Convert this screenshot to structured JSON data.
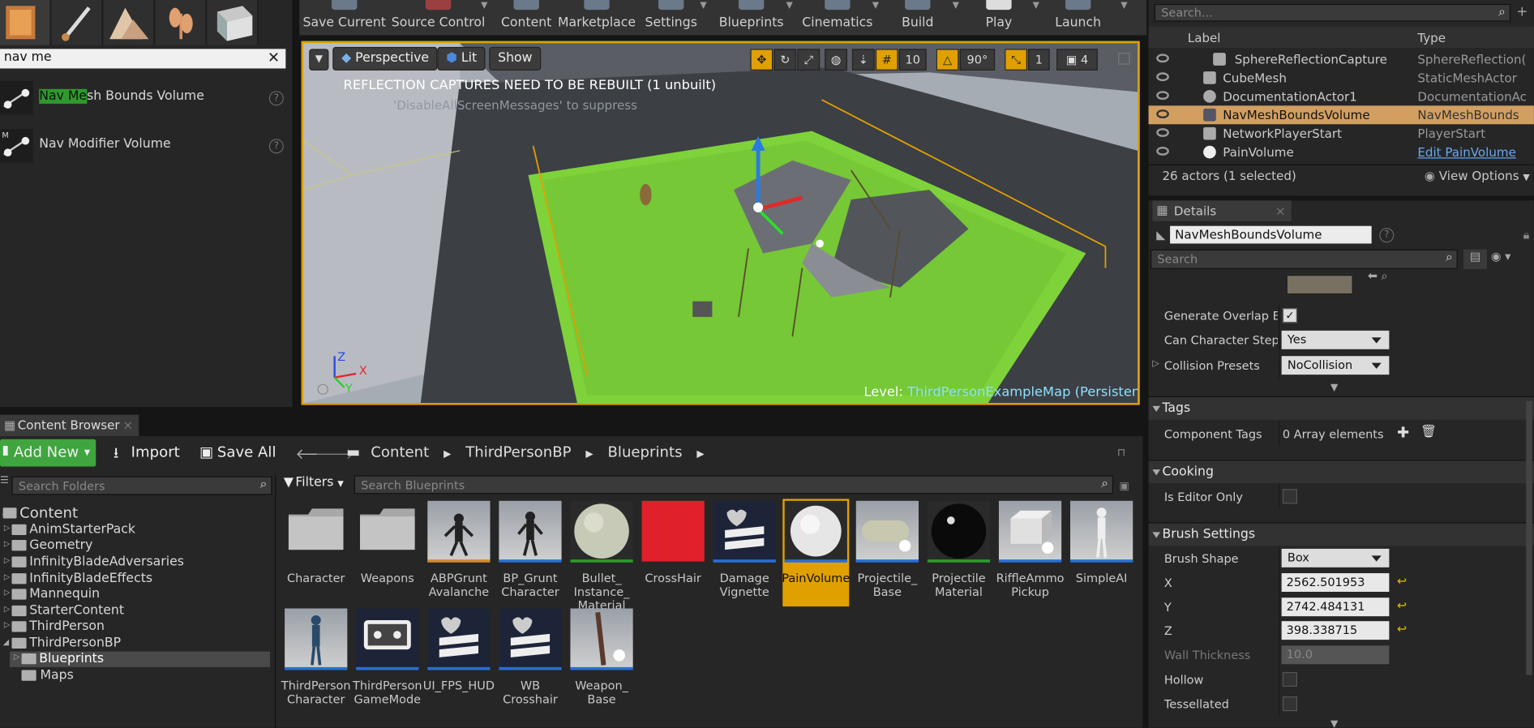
{
  "place": {
    "search_value": "nav me",
    "items": [
      {
        "pre": "Nav Me",
        "rest": "sh Bounds Volume"
      },
      {
        "pre": "",
        "rest": "Nav Modifier Volume"
      }
    ]
  },
  "toolbar": {
    "items": [
      "Save Current",
      "Source Control",
      "Content",
      "Marketplace",
      "Settings",
      "Blueprints",
      "Cinematics",
      "Build",
      "Play",
      "Launch"
    ]
  },
  "viewport": {
    "perspective": "Perspective",
    "lit": "Lit",
    "show": "Show",
    "warning": "REFLECTION CAPTURES NEED TO BE REBUILT (1 unbuilt)",
    "hint": "'DisableAllScreenMessages' to suppress",
    "level_label": "Level:",
    "level_name": "ThirdPersonExampleMap (Persistent)",
    "grid_snap": "10",
    "rot_snap": "90°",
    "scale_snap": "1",
    "cam_speed": "4",
    "axis_z": "Z",
    "axis_x": "X",
    "axis_y": "Y"
  },
  "outliner": {
    "search_placeholder": "Search...",
    "col_label": "Label",
    "col_type": "Type",
    "rows": [
      {
        "label": "SphereReflectionCapture",
        "type": "SphereReflection("
      },
      {
        "label": "CubeMesh",
        "type": "StaticMeshActor"
      },
      {
        "label": "DocumentationActor1",
        "type": "DocumentationAc"
      },
      {
        "label": "NavMeshBoundsVolume",
        "type": "NavMeshBounds"
      },
      {
        "label": "NetworkPlayerStart",
        "type": "PlayerStart"
      },
      {
        "label": "PainVolume",
        "type": "Edit PainVolume"
      }
    ],
    "status": "26 actors (1 selected)",
    "view_options": "View Options"
  },
  "details": {
    "tab": "Details",
    "name_value": "NavMeshBoundsVolume",
    "search_placeholder": "Search",
    "generate_overlap": "Generate Overlap Eve",
    "can_step": "Can Character Step U",
    "can_step_value": "Yes",
    "collision_presets": "Collision Presets",
    "collision_value": "NoCollision",
    "cat_tags": "Tags",
    "component_tags": "Component Tags",
    "component_tags_value": "0 Array elements",
    "cat_cooking": "Cooking",
    "editor_only": "Is Editor Only",
    "cat_brush": "Brush Settings",
    "brush_shape": "Brush Shape",
    "brush_shape_value": "Box",
    "x_label": "X",
    "x_value": "2562.501953",
    "y_label": "Y",
    "y_value": "2742.484131",
    "z_label": "Z",
    "z_value": "398.338715",
    "wall_label": "Wall Thickness",
    "wall_value": "10.0",
    "hollow": "Hollow",
    "tessellated": "Tessellated"
  },
  "content_browser": {
    "tab": "Content Browser",
    "add_new": "Add New",
    "import": "Import",
    "save_all": "Save All",
    "path": [
      "Content",
      "ThirdPersonBP",
      "Blueprints"
    ],
    "search_folders": "Search Folders",
    "filters": "Filters",
    "search_blueprints": "Search Blueprints",
    "folders": [
      {
        "name": "Content",
        "level": 0
      },
      {
        "name": "AnimStarterPack",
        "level": 1
      },
      {
        "name": "Geometry",
        "level": 1
      },
      {
        "name": "InfinityBladeAdversaries",
        "level": 1
      },
      {
        "name": "InfinityBladeEffects",
        "level": 1
      },
      {
        "name": "Mannequin",
        "level": 1
      },
      {
        "name": "StarterContent",
        "level": 1
      },
      {
        "name": "ThirdPerson",
        "level": 1
      },
      {
        "name": "ThirdPersonBP",
        "level": 1
      },
      {
        "name": "Blueprints",
        "level": 2
      },
      {
        "name": "Maps",
        "level": 2
      }
    ],
    "assets": [
      {
        "name": "Character",
        "bar": ""
      },
      {
        "name": "Weapons",
        "bar": ""
      },
      {
        "name": "ABPGrunt Avalanche",
        "bar": "#2a6dd6"
      },
      {
        "name": "BP_Grunt Character",
        "bar": "#2a6dd6"
      },
      {
        "name": "Bullet_ Instance_ Material",
        "bar": "#2a9d2a"
      },
      {
        "name": "CrossHair",
        "bar": ""
      },
      {
        "name": "Damage Vignette",
        "bar": "#2a6dd6"
      },
      {
        "name": "PainVolume",
        "bar": "#2a6dd6"
      },
      {
        "name": "Projectile_ Base",
        "bar": "#2a6dd6"
      },
      {
        "name": "Projectile Material",
        "bar": "#2a9d2a"
      },
      {
        "name": "RiffleAmmo Pickup",
        "bar": "#2a6dd6"
      },
      {
        "name": "SimpleAI",
        "bar": "#2a6dd6"
      },
      {
        "name": "ThirdPerson Character",
        "bar": "#2a6dd6"
      },
      {
        "name": "ThirdPerson GameMode",
        "bar": "#2a6dd6"
      },
      {
        "name": "UI_FPS_HUD",
        "bar": "#2a6dd6"
      },
      {
        "name": "WB Crosshair",
        "bar": "#2a6dd6"
      },
      {
        "name": "Weapon_ Base",
        "bar": "#2a6dd6"
      }
    ]
  },
  "colors": {
    "accent_orange": "#e0a000",
    "selection": "#d29f61",
    "add_new_green": "#3fa53f",
    "nav_mesh_green": "#7ed33a"
  }
}
